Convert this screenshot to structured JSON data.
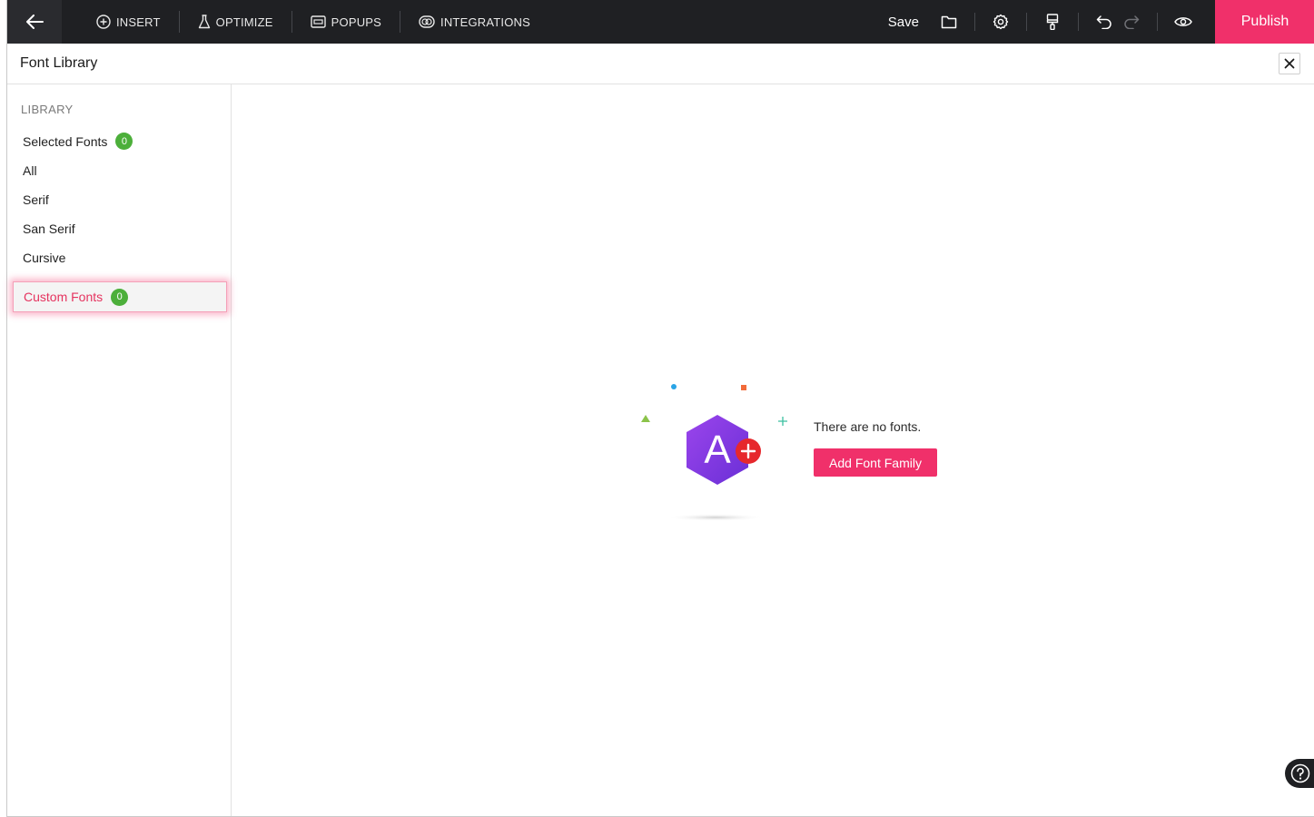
{
  "topbar": {
    "nav": [
      {
        "label": "INSERT",
        "icon": "plus-circle-icon"
      },
      {
        "label": "OPTIMIZE",
        "icon": "flask-icon"
      },
      {
        "label": "POPUPS",
        "icon": "popup-window-icon"
      },
      {
        "label": "INTEGRATIONS",
        "icon": "integrations-icon"
      }
    ],
    "save_label": "Save",
    "publish_label": "Publish",
    "accent_color": "#f0306a"
  },
  "library": {
    "title": "Font Library",
    "section_label": "LIBRARY",
    "items": [
      {
        "label": "Selected Fonts",
        "count": "0"
      },
      {
        "label": "All"
      },
      {
        "label": "Serif"
      },
      {
        "label": "San Serif"
      },
      {
        "label": "Cursive"
      }
    ],
    "custom": {
      "label": "Custom Fonts",
      "count": "0"
    }
  },
  "empty_state": {
    "message": "There are no fonts.",
    "button_label": "Add Font Family",
    "icon_letter": "A"
  }
}
